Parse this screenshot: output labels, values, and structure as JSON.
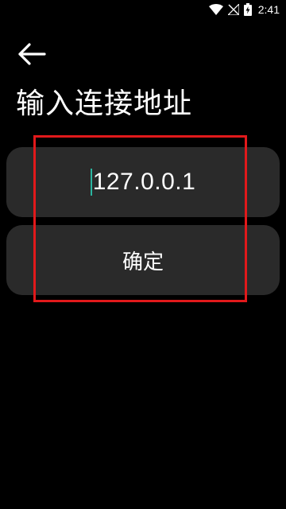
{
  "status_bar": {
    "time": "2:41",
    "icons": [
      "wifi-icon",
      "no-signal-icon",
      "battery-icon"
    ]
  },
  "header": {
    "back_icon": "arrow-left-icon",
    "title": "输入连接地址"
  },
  "address_field": {
    "value": "127.0.0.1"
  },
  "confirm_button": {
    "label": "确定"
  },
  "colors": {
    "background": "#000000",
    "card": "#2a2a2a",
    "cursor": "#2bb5a0",
    "highlight": "#e1191b",
    "text": "#ffffff"
  }
}
